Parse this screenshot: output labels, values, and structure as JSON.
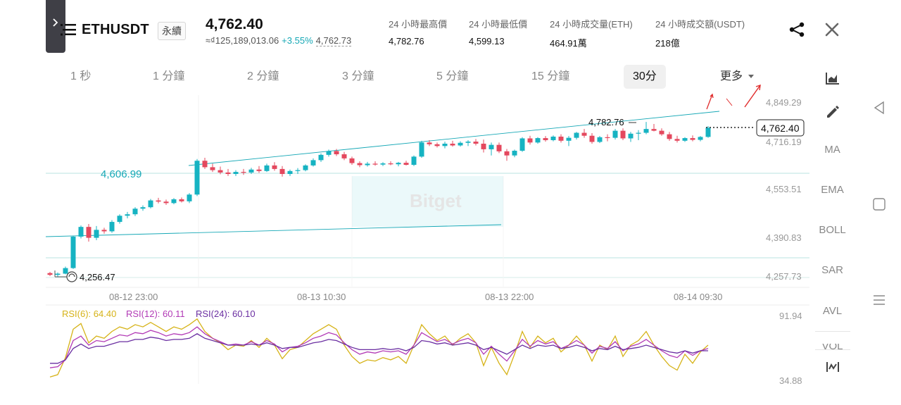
{
  "header": {
    "symbol": "ETHUSDT",
    "contract_type": "永續",
    "last_price": "4,762.40",
    "fiat_price": "≈₫125,189,013.06",
    "change_pct": "+3.55%",
    "mark_price": "4,762.73",
    "stats": [
      {
        "label": "24 小時最高價",
        "value": "4,782.76"
      },
      {
        "label": "24 小時最低價",
        "value": "4,599.13"
      },
      {
        "label": "24 小時成交量(ETH)",
        "value": "464.91萬"
      },
      {
        "label": "24 小時成交額(USDT)",
        "value": "218億"
      }
    ]
  },
  "timeframes": [
    {
      "label": "1 秒",
      "active": false
    },
    {
      "label": "1 分鐘",
      "active": false
    },
    {
      "label": "2 分鐘",
      "active": false
    },
    {
      "label": "3 分鐘",
      "active": false
    },
    {
      "label": "5 分鐘",
      "active": false
    },
    {
      "label": "15 分鐘",
      "active": false
    },
    {
      "label": "30分",
      "active": true
    }
  ],
  "more_label": "更多",
  "indicators": [
    "MA",
    "EMA",
    "BOLL",
    "SAR",
    "AVL",
    "VOL"
  ],
  "chart_data": {
    "type": "candlestick",
    "watermark": "Bitget",
    "price_axis": [
      "4,849.29",
      "4,716.19",
      "4,553.51",
      "4,390.83",
      "4,257.73"
    ],
    "time_axis": [
      "08-12 23:00",
      "08-13 10:30",
      "08-13 22:00",
      "08-14 09:30"
    ],
    "current_price_label": "4,762.40",
    "high_label": "4,782.76",
    "low_label": "4,256.47",
    "horizontal_line_label": "4,606.99",
    "ohlc": [
      [
        4268,
        4272,
        4258,
        4262
      ],
      [
        4262,
        4270,
        4256,
        4266
      ],
      [
        4266,
        4290,
        4264,
        4285
      ],
      [
        4285,
        4395,
        4282,
        4392
      ],
      [
        4392,
        4430,
        4386,
        4425
      ],
      [
        4425,
        4435,
        4375,
        4388
      ],
      [
        4388,
        4428,
        4380,
        4415
      ],
      [
        4415,
        4422,
        4402,
        4410
      ],
      [
        4410,
        4448,
        4405,
        4442
      ],
      [
        4442,
        4468,
        4436,
        4463
      ],
      [
        4463,
        4476,
        4454,
        4468
      ],
      [
        4468,
        4492,
        4462,
        4487
      ],
      [
        4487,
        4498,
        4480,
        4492
      ],
      [
        4492,
        4520,
        4488,
        4515
      ],
      [
        4515,
        4524,
        4505,
        4511
      ],
      [
        4511,
        4518,
        4500,
        4506
      ],
      [
        4506,
        4523,
        4502,
        4519
      ],
      [
        4519,
        4525,
        4508,
        4512
      ],
      [
        4512,
        4540,
        4506,
        4535
      ],
      [
        4535,
        4656,
        4530,
        4650
      ],
      [
        4650,
        4660,
        4622,
        4628
      ],
      [
        4628,
        4640,
        4612,
        4618
      ],
      [
        4618,
        4630,
        4604,
        4610
      ],
      [
        4610,
        4622,
        4598,
        4605
      ],
      [
        4605,
        4618,
        4598,
        4612
      ],
      [
        4612,
        4622,
        4602,
        4610
      ],
      [
        4610,
        4626,
        4605,
        4620
      ],
      [
        4620,
        4632,
        4609,
        4615
      ],
      [
        4615,
        4640,
        4612,
        4634
      ],
      [
        4634,
        4645,
        4616,
        4622
      ],
      [
        4622,
        4632,
        4596,
        4605
      ],
      [
        4605,
        4620,
        4598,
        4615
      ],
      [
        4615,
        4625,
        4605,
        4618
      ],
      [
        4618,
        4638,
        4614,
        4634
      ],
      [
        4634,
        4658,
        4630,
        4652
      ],
      [
        4652,
        4675,
        4646,
        4670
      ],
      [
        4670,
        4688,
        4664,
        4683
      ],
      [
        4683,
        4690,
        4666,
        4672
      ],
      [
        4672,
        4680,
        4652,
        4658
      ],
      [
        4658,
        4664,
        4636,
        4642
      ],
      [
        4642,
        4648,
        4628,
        4635
      ],
      [
        4635,
        4646,
        4630,
        4640
      ],
      [
        4640,
        4648,
        4633,
        4637
      ],
      [
        4637,
        4645,
        4632,
        4641
      ],
      [
        4641,
        4648,
        4635,
        4638
      ],
      [
        4638,
        4646,
        4631,
        4643
      ],
      [
        4643,
        4650,
        4634,
        4636
      ],
      [
        4636,
        4668,
        4632,
        4664
      ],
      [
        4664,
        4718,
        4660,
        4712
      ],
      [
        4712,
        4720,
        4700,
        4706
      ],
      [
        4706,
        4712,
        4695,
        4700
      ],
      [
        4700,
        4715,
        4692,
        4708
      ],
      [
        4708,
        4718,
        4698,
        4702
      ],
      [
        4702,
        4716,
        4698,
        4711
      ],
      [
        4711,
        4720,
        4700,
        4715
      ],
      [
        4715,
        4724,
        4702,
        4708
      ],
      [
        4708,
        4722,
        4678,
        4689
      ],
      [
        4689,
        4712,
        4668,
        4704
      ],
      [
        4704,
        4712,
        4676,
        4682
      ],
      [
        4682,
        4690,
        4650,
        4668
      ],
      [
        4668,
        4688,
        4662,
        4684
      ],
      [
        4684,
        4730,
        4680,
        4726
      ],
      [
        4726,
        4735,
        4705,
        4712
      ],
      [
        4712,
        4730,
        4708,
        4727
      ],
      [
        4727,
        4734,
        4715,
        4720
      ],
      [
        4720,
        4736,
        4716,
        4732
      ],
      [
        4732,
        4740,
        4712,
        4718
      ],
      [
        4718,
        4734,
        4700,
        4728
      ],
      [
        4728,
        4748,
        4722,
        4745
      ],
      [
        4745,
        4758,
        4728,
        4735
      ],
      [
        4735,
        4744,
        4708,
        4714
      ],
      [
        4714,
        4734,
        4710,
        4730
      ],
      [
        4730,
        4740,
        4716,
        4728
      ],
      [
        4728,
        4758,
        4722,
        4752
      ],
      [
        4752,
        4760,
        4720,
        4726
      ],
      [
        4726,
        4748,
        4714,
        4742
      ],
      [
        4742,
        4754,
        4720,
        4745
      ],
      [
        4745,
        4782,
        4740,
        4758
      ],
      [
        4758,
        4775,
        4750,
        4752
      ],
      [
        4752,
        4760,
        4735,
        4740
      ],
      [
        4740,
        4748,
        4718,
        4724
      ],
      [
        4724,
        4735,
        4712,
        4718
      ],
      [
        4718,
        4730,
        4714,
        4727
      ],
      [
        4727,
        4736,
        4716,
        4721
      ],
      [
        4721,
        4734,
        4716,
        4731
      ],
      [
        4731,
        4768,
        4728,
        4762
      ]
    ],
    "rsi": {
      "scale_top": "91.94",
      "scale_bottom": "34.88",
      "labels": [
        {
          "text": "RSI(6): 64.40",
          "color": "#d6b318"
        },
        {
          "text": "RSI(12): 60.11",
          "color": "#b23ab6"
        },
        {
          "text": "RSI(24): 60.10",
          "color": "#6a2ea1"
        }
      ],
      "rsi6": [
        38,
        40,
        55,
        80,
        85,
        68,
        74,
        72,
        78,
        82,
        80,
        84,
        82,
        86,
        82,
        78,
        82,
        80,
        84,
        89,
        78,
        72,
        68,
        62,
        66,
        65,
        70,
        64,
        72,
        66,
        54,
        62,
        64,
        70,
        76,
        80,
        84,
        80,
        66,
        56,
        50,
        53,
        52,
        55,
        53,
        56,
        50,
        66,
        84,
        76,
        70,
        74,
        66,
        72,
        76,
        68,
        48,
        64,
        50,
        40,
        58,
        78,
        64,
        74,
        68,
        72,
        60,
        66,
        74,
        66,
        52,
        66,
        62,
        74,
        56,
        66,
        70,
        78,
        66,
        56,
        48,
        44,
        58,
        50,
        60,
        66
      ],
      "rsi12": [
        46,
        47,
        53,
        70,
        74,
        66,
        70,
        69,
        72,
        75,
        74,
        77,
        76,
        79,
        77,
        74,
        76,
        75,
        77,
        82,
        76,
        72,
        69,
        66,
        67,
        66,
        69,
        66,
        70,
        67,
        60,
        64,
        65,
        68,
        72,
        74,
        77,
        75,
        68,
        62,
        58,
        60,
        59,
        61,
        60,
        61,
        58,
        66,
        77,
        73,
        69,
        71,
        67,
        70,
        72,
        68,
        58,
        65,
        58,
        52,
        61,
        71,
        65,
        70,
        67,
        69,
        63,
        66,
        70,
        66,
        59,
        65,
        63,
        69,
        61,
        65,
        67,
        71,
        66,
        61,
        57,
        55,
        61,
        57,
        61,
        63
      ],
      "rsi24": [
        50,
        50,
        53,
        63,
        67,
        63,
        65,
        65,
        67,
        69,
        69,
        71,
        71,
        73,
        72,
        70,
        71,
        71,
        72,
        76,
        72,
        70,
        68,
        66,
        66,
        66,
        67,
        66,
        68,
        66,
        63,
        64,
        64,
        66,
        68,
        69,
        71,
        70,
        67,
        64,
        62,
        62,
        62,
        63,
        62,
        63,
        61,
        64,
        70,
        69,
        67,
        68,
        66,
        67,
        68,
        66,
        62,
        64,
        61,
        58,
        62,
        66,
        63,
        66,
        65,
        66,
        63,
        64,
        66,
        64,
        61,
        63,
        62,
        65,
        62,
        63,
        64,
        66,
        64,
        62,
        60,
        59,
        61,
        59,
        61,
        61
      ]
    }
  }
}
